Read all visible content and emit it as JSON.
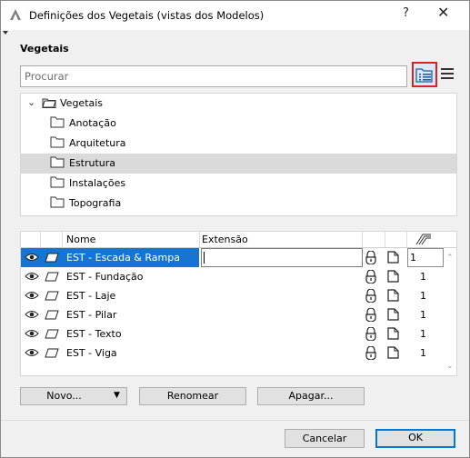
{
  "window": {
    "title": "Definições dos Vegetais (vistas dos Modelos)",
    "help": "?",
    "close": "✕"
  },
  "section_title": "Vegetais",
  "search": {
    "placeholder": "Procurar"
  },
  "tree": {
    "root": "Vegetais",
    "items": [
      "Anotação",
      "Arquitetura",
      "Estrutura",
      "Instalações",
      "Topografia"
    ],
    "selected": "Estrutura"
  },
  "table": {
    "headers": {
      "name": "Nome",
      "extension": "Extensão"
    },
    "rows": [
      {
        "name": "EST - Escada & Rampa",
        "value": "1"
      },
      {
        "name": "EST - Fundação",
        "value": "1"
      },
      {
        "name": "EST - Laje",
        "value": "1"
      },
      {
        "name": "EST - Pilar",
        "value": "1"
      },
      {
        "name": "EST - Texto",
        "value": "1"
      },
      {
        "name": "EST - Viga",
        "value": "1"
      }
    ]
  },
  "buttons": {
    "new": "Novo...",
    "rename": "Renomear",
    "delete": "Apagar...",
    "cancel": "Cancelar",
    "ok": "OK"
  },
  "icons": {
    "app": "archicad-icon",
    "folder_view": "folder-list-icon",
    "list_view": "list-icon",
    "visibility": "eye-icon",
    "layer": "layer-icon",
    "lock": "lock-icon",
    "document": "document-icon",
    "intersection": "intersection-icon"
  },
  "colors": {
    "selection": "#1675d1",
    "highlight_border": "#e02020",
    "ok_border": "#0078d7"
  }
}
